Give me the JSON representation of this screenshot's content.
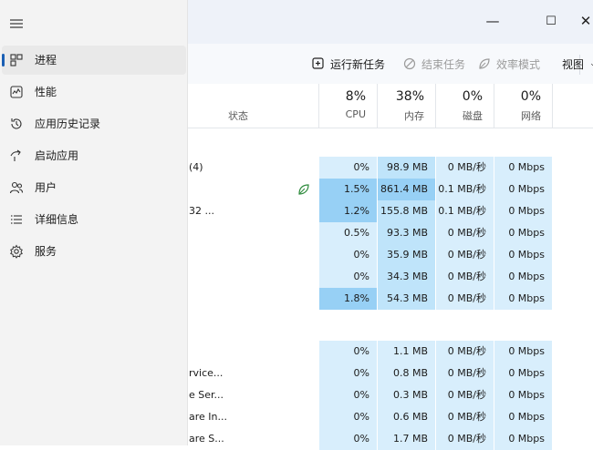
{
  "window": {
    "minimize_icon": "—",
    "maximize_icon": "☐",
    "close_icon": "✕"
  },
  "toolbar": {
    "run_new_task": "运行新任务",
    "end_task": "结束任务",
    "efficiency_mode": "效率模式",
    "view": "视图"
  },
  "sidebar": {
    "items": [
      {
        "label": "进程",
        "icon": "processes-icon",
        "active": true
      },
      {
        "label": "性能",
        "icon": "performance-icon"
      },
      {
        "label": "应用历史记录",
        "icon": "app-history-icon"
      },
      {
        "label": "启动应用",
        "icon": "startup-apps-icon"
      },
      {
        "label": "用户",
        "icon": "users-icon"
      },
      {
        "label": "详细信息",
        "icon": "details-icon"
      },
      {
        "label": "服务",
        "icon": "services-icon"
      }
    ]
  },
  "columns": {
    "status": "状态",
    "cpu": {
      "pct": "8%",
      "name": "CPU"
    },
    "memory": {
      "pct": "38%",
      "name": "内存"
    },
    "disk": {
      "pct": "0%",
      "name": "磁盘"
    },
    "network": {
      "pct": "0%",
      "name": "网络"
    }
  },
  "rows": [
    {
      "name": "(4)",
      "cpu": "0%",
      "mem": "98.9 MB",
      "disk": "0 MB/秒",
      "net": "0 Mbps"
    },
    {
      "name": "",
      "cpu": "1.5%",
      "mem": "861.4 MB",
      "disk": "0.1 MB/秒",
      "net": "0 Mbps",
      "efficiency": true
    },
    {
      "name": "32 ...",
      "cpu": "1.2%",
      "mem": "155.8 MB",
      "disk": "0.1 MB/秒",
      "net": "0 Mbps"
    },
    {
      "name": "",
      "cpu": "0.5%",
      "mem": "93.3 MB",
      "disk": "0 MB/秒",
      "net": "0 Mbps"
    },
    {
      "name": "",
      "cpu": "0%",
      "mem": "35.9 MB",
      "disk": "0 MB/秒",
      "net": "0 Mbps"
    },
    {
      "name": "",
      "cpu": "0%",
      "mem": "34.3 MB",
      "disk": "0 MB/秒",
      "net": "0 Mbps"
    },
    {
      "name": "",
      "cpu": "1.8%",
      "mem": "54.3 MB",
      "disk": "0 MB/秒",
      "net": "0 Mbps"
    },
    {
      "name": "",
      "cpu": "0%",
      "mem": "1.1 MB",
      "disk": "0 MB/秒",
      "net": "0 Mbps"
    },
    {
      "name": "rvice...",
      "cpu": "0%",
      "mem": "0.8 MB",
      "disk": "0 MB/秒",
      "net": "0 Mbps"
    },
    {
      "name": "e Ser...",
      "cpu": "0%",
      "mem": "0.3 MB",
      "disk": "0 MB/秒",
      "net": "0 Mbps"
    },
    {
      "name": "are In...",
      "cpu": "0%",
      "mem": "0.6 MB",
      "disk": "0 MB/秒",
      "net": "0 Mbps"
    },
    {
      "name": "are S...",
      "cpu": "0%",
      "mem": "1.7 MB",
      "disk": "0 MB/秒",
      "net": "0 Mbps"
    }
  ],
  "colors": {
    "heat_light": "#d8eefc",
    "heat_medium": "#bfe4fa",
    "heat_strong": "#97d0f5",
    "accent": "#1a5fb4"
  }
}
